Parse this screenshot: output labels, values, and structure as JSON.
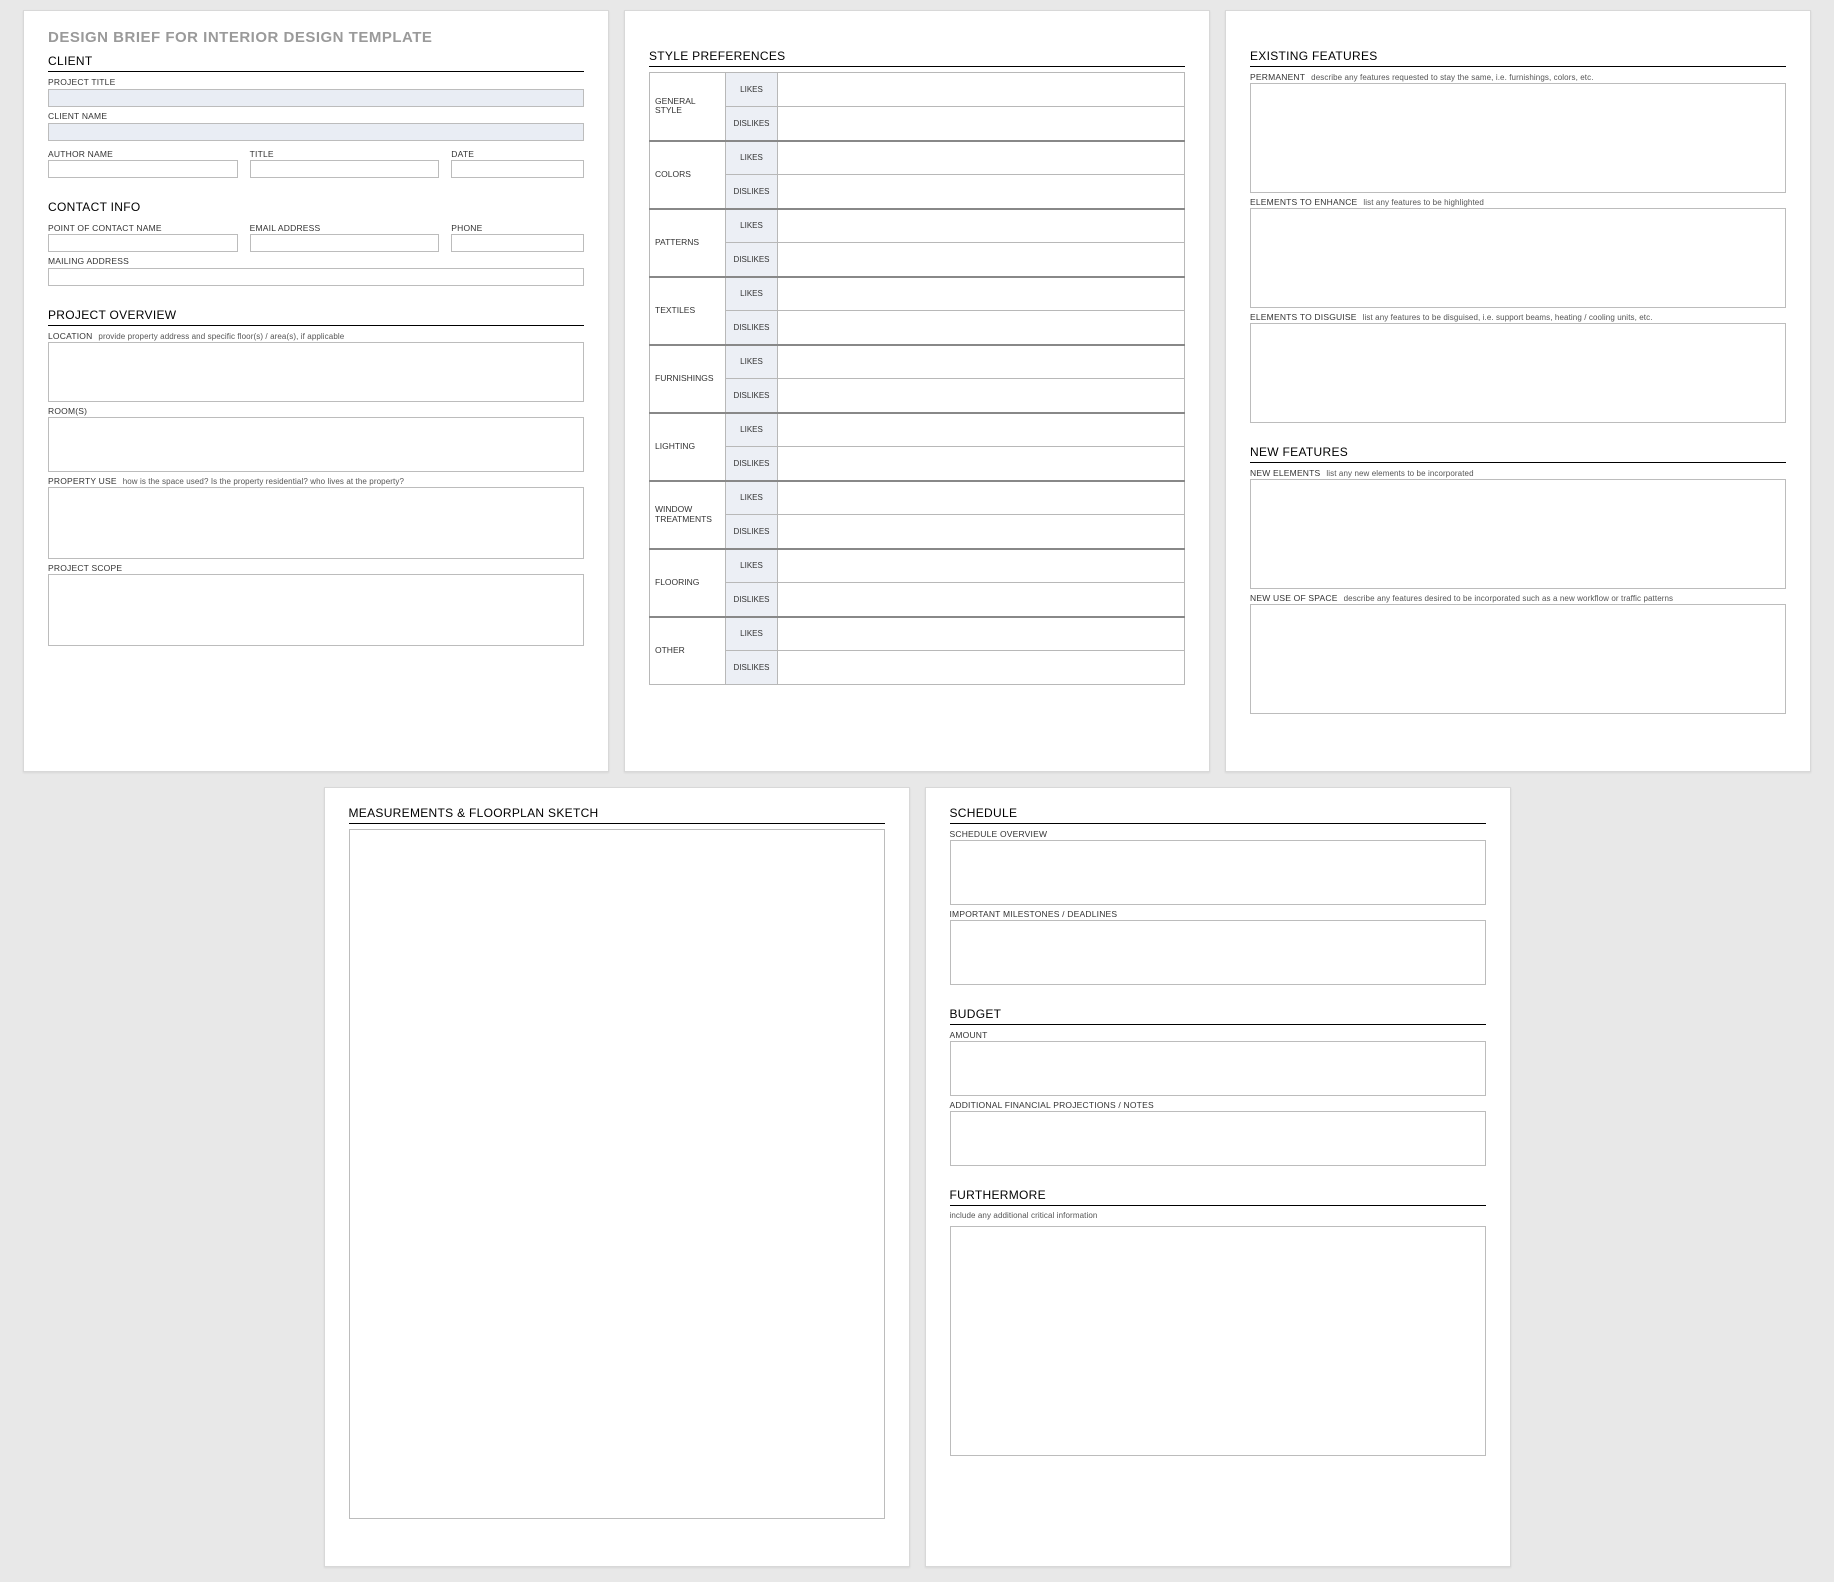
{
  "mainTitle": "DESIGN BRIEF FOR INTERIOR DESIGN TEMPLATE",
  "sections": {
    "client": "CLIENT",
    "contactInfo": "CONTACT INFO",
    "projectOverview": "PROJECT OVERVIEW",
    "stylePrefs": "STYLE PREFERENCES",
    "existingFeatures": "EXISTING FEATURES",
    "newFeatures": "NEW FEATURES",
    "sketch": "MEASUREMENTS & FLOORPLAN SKETCH",
    "schedule": "SCHEDULE",
    "budget": "BUDGET",
    "furthermore": "FURTHERMORE"
  },
  "labels": {
    "projectTitle": "PROJECT TITLE",
    "clientName": "CLIENT NAME",
    "authorName": "AUTHOR NAME",
    "title": "TITLE",
    "date": "DATE",
    "poc": "POINT OF CONTACT NAME",
    "email": "EMAIL ADDRESS",
    "phone": "PHONE",
    "mailing": "MAILING ADDRESS",
    "location": "LOCATION",
    "locationHint": "provide property address and specific floor(s) / area(s), if applicable",
    "rooms": "ROOM(S)",
    "propUse": "PROPERTY USE",
    "propUseHint": "how is the space used?  Is the property residential? who lives at the property?",
    "projectScope": "PROJECT SCOPE",
    "permanent": "PERMANENT",
    "permanentHint": "describe any features requested to stay the same, i.e. furnishings, colors, etc.",
    "enhance": "ELEMENTS TO ENHANCE",
    "enhanceHint": "list any features to be highlighted",
    "disguise": "ELEMENTS TO DISGUISE",
    "disguiseHint": "list any features to be disguised, i.e. support beams, heating / cooling units, etc.",
    "newEl": "NEW ELEMENTS",
    "newElHint": "list any new elements to be incorporated",
    "newUse": "NEW USE OF SPACE",
    "newUseHint": "describe any features desired to be incorporated such as a new workflow or traffic patterns",
    "scheduleOverview": "SCHEDULE OVERVIEW",
    "milestones": "IMPORTANT MILESTONES / DEADLINES",
    "amount": "AMOUNT",
    "finNotes": "ADDITIONAL FINANCIAL PROJECTIONS / NOTES",
    "furthermoreHint": "include any additional critical information"
  },
  "styleRows": [
    {
      "cat": "GENERAL STYLE"
    },
    {
      "cat": "COLORS"
    },
    {
      "cat": "PATTERNS"
    },
    {
      "cat": "TEXTILES"
    },
    {
      "cat": "FURNISHINGS"
    },
    {
      "cat": "LIGHTING"
    },
    {
      "cat": "WINDOW TREATMENTS"
    },
    {
      "cat": "FLOORING"
    },
    {
      "cat": "OTHER"
    }
  ],
  "styleOpts": {
    "likes": "LIKES",
    "dislikes": "DISLIKES"
  },
  "values": {
    "projectTitle": "",
    "clientName": "",
    "authorName": "",
    "title": "",
    "date": "",
    "poc": "",
    "email": "",
    "phone": "",
    "mailing": "",
    "location": "",
    "rooms": "",
    "propUse": "",
    "projectScope": "",
    "permanent": "",
    "enhance": "",
    "disguise": "",
    "newEl": "",
    "newUse": "",
    "scheduleOverview": "",
    "milestones": "",
    "amount": "",
    "finNotes": "",
    "furthermore": ""
  }
}
